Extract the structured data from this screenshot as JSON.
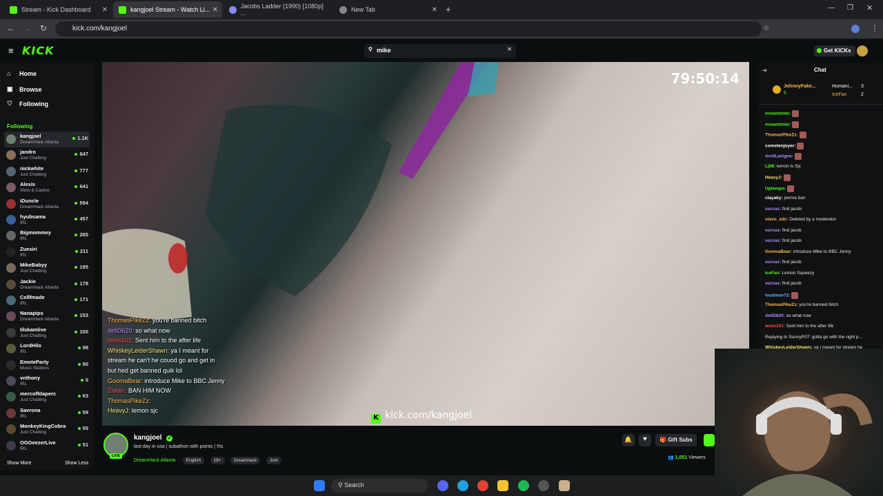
{
  "browser": {
    "tabs": [
      {
        "label": "Stream - Kick Dashboard",
        "active": false
      },
      {
        "label": "kangjoel Stream - Watch Li...",
        "active": true
      },
      {
        "label": "Jacobs Ladder (1990) [1080p] ...",
        "active": false
      },
      {
        "label": "New Tab",
        "active": false
      }
    ],
    "url": "kick.com/kangjoel"
  },
  "header": {
    "logo": "KICK",
    "search_value": "mike",
    "get_kicks": "Get KICKs"
  },
  "sidebar": {
    "nav": [
      {
        "label": "Home",
        "icon": "home-icon"
      },
      {
        "label": "Browse",
        "icon": "browse-icon"
      },
      {
        "label": "Following",
        "icon": "heart-icon"
      }
    ],
    "following_heading": "Following",
    "channels": [
      {
        "name": "kangjoel",
        "category": "DreamHack Atlanta",
        "viewers": "1.1K",
        "color": "#6f8070"
      },
      {
        "name": "jandro",
        "category": "Just Chatting",
        "viewers": "847",
        "color": "#8a6f5a"
      },
      {
        "name": "nickwhite",
        "category": "Just Chatting",
        "viewers": "777",
        "color": "#556677"
      },
      {
        "name": "Alexis",
        "category": "Slots & Casino",
        "viewers": "641",
        "color": "#7a5a66"
      },
      {
        "name": "iDuncle",
        "category": "DreamHack Atlanta",
        "viewers": "594",
        "color": "#993333"
      },
      {
        "name": "hyubsama",
        "category": "IRL",
        "viewers": "457",
        "color": "#3a5f9a"
      },
      {
        "name": "Bigmommey",
        "category": "IRL",
        "viewers": "265",
        "color": "#666666"
      },
      {
        "name": "Zuesiri",
        "category": "IRL",
        "viewers": "211",
        "color": "#222222"
      },
      {
        "name": "MikeBabyy",
        "category": "Just Chatting",
        "viewers": "195",
        "color": "#7a6a5a"
      },
      {
        "name": "Jackie",
        "category": "DreamHack Atlanta",
        "viewers": "178",
        "color": "#5a4a3a"
      },
      {
        "name": "Cellfmade",
        "category": "IRL",
        "viewers": "171",
        "color": "#4a6a7a"
      },
      {
        "name": "Nanapips",
        "category": "DreamHack Atlanta",
        "viewers": "153",
        "color": "#6a4a5a"
      },
      {
        "name": "Iilskamlive",
        "category": "Just Chatting",
        "viewers": "100",
        "color": "#3a3a3a"
      },
      {
        "name": "LordHilo",
        "category": "IRL",
        "viewers": "98",
        "color": "#5a5a3a"
      },
      {
        "name": "EmoteParty",
        "category": "Music Stations",
        "viewers": "90",
        "color": "#2a2a2a"
      },
      {
        "name": "vnthony",
        "category": "IRL",
        "viewers": "0",
        "color": "#4a4a5a"
      },
      {
        "name": "mercoffdaperc",
        "category": "Just Chatting",
        "viewers": "63",
        "color": "#3a5a4a"
      },
      {
        "name": "Savrona",
        "category": "IRL",
        "viewers": "59",
        "color": "#6a3a3a"
      },
      {
        "name": "MonkeyKingCobra",
        "category": "Just Chatting",
        "viewers": "55",
        "color": "#5a4a2a"
      },
      {
        "name": "OGGeezerLive",
        "category": "IRL",
        "viewers": "51",
        "color": "#3a3a4a"
      }
    ],
    "show_more": "Show More",
    "show_less": "Show Less"
  },
  "video": {
    "timer": "79:50:14",
    "watermark": "kick.com/kangjoel",
    "overlay_chat": [
      {
        "user": "ThomasPikeZz:",
        "text": " you're banned bitch",
        "color": "#ffb84d"
      },
      {
        "user": "deliD620:",
        "text": " so what now",
        "color": "#b38cff"
      },
      {
        "user": "lewis101:",
        "text": " Sent him to the after life",
        "color": "#ff4d4d"
      },
      {
        "user": "WhiskeyLeiderShawn:",
        "text": " ya I meant for",
        "color": "#ffe066"
      },
      {
        "user": "",
        "text": "stream he can't he couod go and get in",
        "color": "#ffffff"
      },
      {
        "user": "",
        "text": "but hed get banned quik lol",
        "color": "#ffffff"
      },
      {
        "user": "GoomaBear:",
        "text": " introduce Mike to BBC Jenny",
        "color": "#ffb84d"
      },
      {
        "user": "Zlatan:",
        "text": " BAN HIM NOW",
        "color": "#ff4d4d"
      },
      {
        "user": "ThomasPikeZz:",
        "text": "",
        "color": "#ffb84d"
      },
      {
        "user": "HeavyJ:",
        "text": " lemon sjc",
        "color": "#ffe066"
      }
    ]
  },
  "stream": {
    "streamer": "kangjoel",
    "live_badge": "LIVE",
    "title": "last day in usa | subathon with points | !!ts",
    "category": "DreamHack Atlanta",
    "tags": [
      "English",
      "18+",
      "Dreamhack",
      "Jool"
    ],
    "gift_subs": "Gift Subs",
    "viewers": "1,051",
    "viewers_label": "Viewers"
  },
  "chat": {
    "title": "Chat",
    "top_gifters": [
      {
        "name": "JohnnyFake...",
        "count": "5"
      },
      {
        "name": "Humani...",
        "count": "3"
      },
      {
        "name": "IceFan",
        "count": "2"
      }
    ],
    "messages": [
      {
        "user": "ovoantonio:",
        "text": "",
        "color": "#53fc18",
        "emote": true
      },
      {
        "user": "ovoantonio:",
        "text": "",
        "color": "#53fc18",
        "emote": true
      },
      {
        "user": "ThomasPikeZz:",
        "text": "",
        "color": "#ffb84d",
        "emote": true
      },
      {
        "user": "cometenjoyer:",
        "text": "",
        "color": "#ffffff",
        "emote": true
      },
      {
        "user": "AvrilLavigne:",
        "text": "",
        "color": "#b38cff",
        "emote": true
      },
      {
        "user": "Lj08:",
        "text": " lemon is Sjc",
        "color": "#53fc18",
        "emote": false
      },
      {
        "user": "HeavyJ:",
        "text": "",
        "color": "#ffe066",
        "emote": true
      },
      {
        "user": "Uptempo:",
        "text": "",
        "color": "#53fc18",
        "emote": true
      },
      {
        "user": "clayaky:",
        "text": " perma ban",
        "color": "#ffffff",
        "emote": false
      },
      {
        "user": "surcas:",
        "text": " find jacob",
        "color": "#b38cff",
        "emote": false
      },
      {
        "user": "slavo_sdc:",
        "text": " Deleted by a moderator",
        "color": "#ffb84d",
        "emote": false
      },
      {
        "user": "surcas:",
        "text": " find jacob",
        "color": "#b38cff",
        "emote": false
      },
      {
        "user": "surcas:",
        "text": " find jacob",
        "color": "#b38cff",
        "emote": false
      },
      {
        "user": "GoomaBear:",
        "text": " introduce Mike to BBC Jenny",
        "color": "#ffb84d",
        "emote": false
      },
      {
        "user": "surcas:",
        "text": " find jacob",
        "color": "#b38cff",
        "emote": false
      },
      {
        "user": "IceFan:",
        "text": " Lemon Squeezy",
        "color": "#53fc18",
        "emote": false
      },
      {
        "user": "surcas:",
        "text": " find jacob",
        "color": "#b38cff",
        "emote": false
      },
      {
        "user": "loudman72:",
        "text": "",
        "color": "#6ab0ff",
        "emote": true
      },
      {
        "user": "ThomasPikeZz:",
        "text": " you're banned bitch",
        "color": "#ffb84d",
        "emote": false
      },
      {
        "user": "deliD620:",
        "text": " so what now",
        "color": "#b38cff",
        "emote": false
      },
      {
        "user": "lewis101:",
        "text": " Sent him to the after life",
        "color": "#ff4d4d",
        "emote": false
      },
      {
        "user": "",
        "text": "Replying to SunnyP07: gotta go with the right p...",
        "color": "#888888",
        "emote": false
      },
      {
        "user": "WhiskeyLeiderShawn:",
        "text": " ya I meant for stream he",
        "color": "#ffe066",
        "emote": false
      }
    ]
  },
  "taskbar": {
    "search_label": "Search"
  }
}
